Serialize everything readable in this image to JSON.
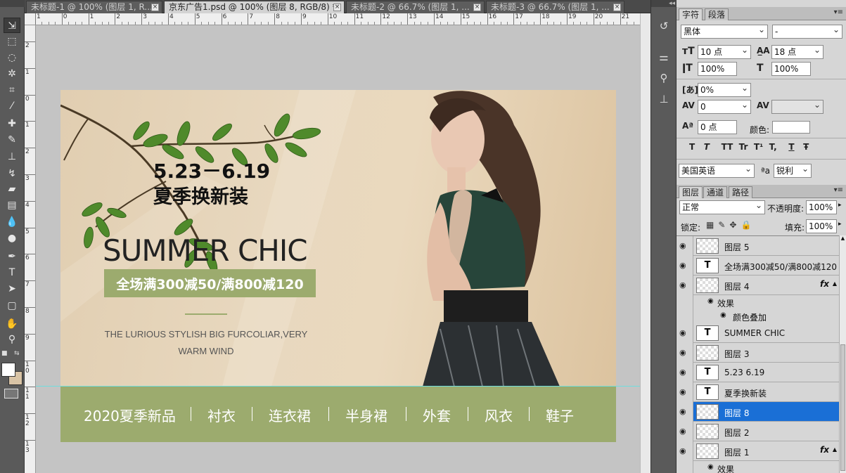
{
  "tabs": [
    {
      "label": "未标题-1 @ 100% (图层 1, R...",
      "active": false
    },
    {
      "label": "京东广告1.psd @ 100% (图层 8, RGB/8) *",
      "active": true
    },
    {
      "label": "未标题-2 @ 66.7% (图层 1, ...",
      "active": false
    },
    {
      "label": "未标题-3 @ 66.7% (图层 1, ...",
      "active": false
    }
  ],
  "tab_close": "×",
  "tools": [
    "move-icon",
    "marquee-icon",
    "lasso-icon",
    "magic-wand-icon",
    "crop-icon",
    "eyedropper-icon",
    "healing-brush-icon",
    "brush-icon",
    "clone-stamp-icon",
    "history-brush-icon",
    "eraser-icon",
    "gradient-icon",
    "blur-icon",
    "dodge-icon",
    "pen-icon",
    "type-icon",
    "path-selection-icon",
    "shape-icon",
    "hand-icon",
    "zoom-icon"
  ],
  "ruler": {
    "h_labels": [
      "1",
      "0",
      "1",
      "2",
      "3",
      "4",
      "5",
      "6",
      "7",
      "8",
      "9",
      "10",
      "11",
      "12",
      "13",
      "14",
      "15",
      "16",
      "17",
      "18",
      "19",
      "20",
      "21"
    ],
    "v_labels": [
      "2",
      "1",
      "0",
      "1",
      "2",
      "3",
      "4",
      "5",
      "6",
      "7",
      "8",
      "9",
      "1\n0",
      "1\n1",
      "1\n2",
      "1\n3"
    ]
  },
  "banner": {
    "date": "5.23－6.19",
    "headline": "夏季换新装",
    "title": "SUMMER CHIC",
    "promo": "全场满300减50/满800减120",
    "subtitle_line1": "THE LURIOUS STYLISH BIG FURCOLIAR,VERY",
    "subtitle_line2": "WARM WIND",
    "nav": [
      "2020夏季新品",
      "衬衣",
      "连衣裙",
      "半身裙",
      "外套",
      "风衣",
      "鞋子"
    ],
    "colors": {
      "banner_bg": "#e6d4b8",
      "accent_green": "#9cab6e",
      "leaf": "#4f8a2b",
      "dress": "#27453a"
    }
  },
  "character_panel": {
    "tabs": [
      "字符",
      "段落"
    ],
    "font_family": "黑体",
    "font_style": "-",
    "font_size": "10 点",
    "leading": "18 点",
    "vertical_scale": "100%",
    "horizontal_scale": "100%",
    "tsume": "0%",
    "tracking": "0",
    "baseline_shift": "0 点",
    "color_label": "颜色:",
    "language": "美国英语",
    "aa_label": "ªa",
    "antialias": "锐利",
    "style_buttons": [
      "T",
      "T",
      "TT",
      "Tr",
      "T¹",
      "T,",
      "T",
      "Ŧ"
    ]
  },
  "layers_panel": {
    "tabs": [
      "图层",
      "通道",
      "路径"
    ],
    "blend_mode": "正常",
    "opacity_label": "不透明度:",
    "opacity": "100%",
    "lock_label": "锁定:",
    "fill_label": "填充:",
    "fill": "100%",
    "layers": [
      {
        "name": "图层 5",
        "kind": "pixel",
        "selected": false,
        "fx": false
      },
      {
        "name": "全场满300减50/满800减120",
        "kind": "text",
        "selected": false,
        "fx": false
      },
      {
        "name": "图层 4",
        "kind": "pixel",
        "selected": false,
        "fx": true
      },
      {
        "name": "效果",
        "kind": "effects",
        "selected": false,
        "fx": false
      },
      {
        "name": "颜色叠加",
        "kind": "effect",
        "selected": false,
        "fx": false
      },
      {
        "name": "SUMMER CHIC",
        "kind": "text",
        "selected": false,
        "fx": false
      },
      {
        "name": "图层 3",
        "kind": "pixel",
        "selected": false,
        "fx": false
      },
      {
        "name": "5.23  6.19",
        "kind": "text",
        "selected": false,
        "fx": false
      },
      {
        "name": "夏季换新装",
        "kind": "text",
        "selected": false,
        "fx": false
      },
      {
        "name": "图层 8",
        "kind": "pixel",
        "selected": true,
        "fx": false
      },
      {
        "name": "图层 2",
        "kind": "pixel",
        "selected": false,
        "fx": false
      },
      {
        "name": "图层 1",
        "kind": "pixel",
        "selected": false,
        "fx": true
      },
      {
        "name": "效果",
        "kind": "effects",
        "selected": false,
        "fx": false
      }
    ],
    "fx_label": "fx",
    "text_thumb": "T"
  }
}
